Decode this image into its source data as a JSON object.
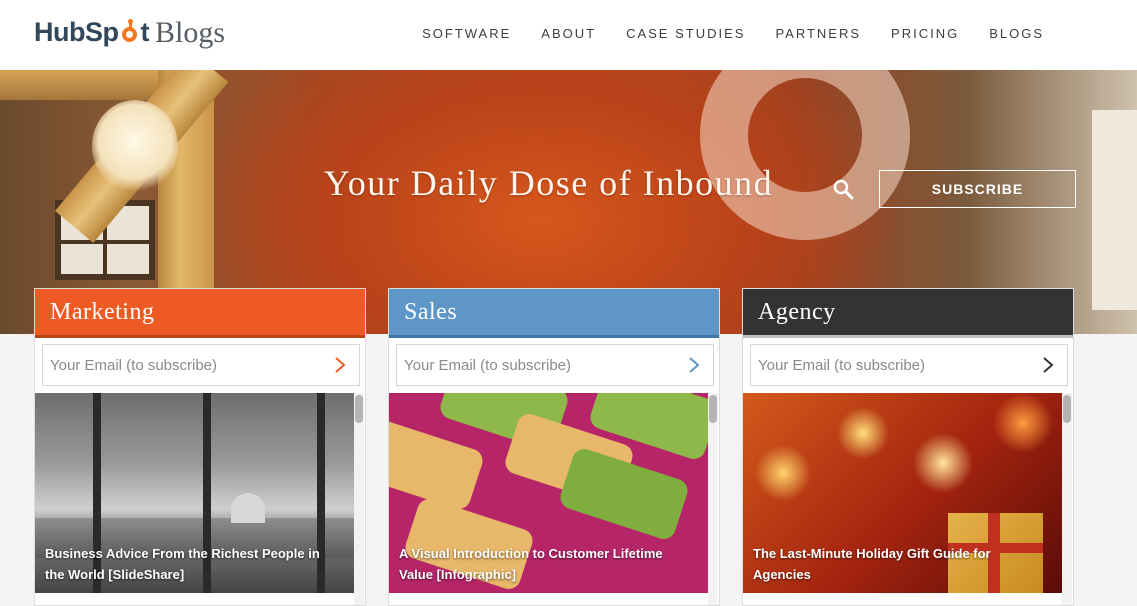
{
  "brand": {
    "logo_hub": "HubSp",
    "logo_t": "t",
    "logo_blogs": "Blogs"
  },
  "nav": [
    {
      "label": "SOFTWARE"
    },
    {
      "label": "ABOUT"
    },
    {
      "label": "CASE STUDIES"
    },
    {
      "label": "PARTNERS"
    },
    {
      "label": "PRICING"
    },
    {
      "label": "BLOGS"
    }
  ],
  "hero": {
    "title": "Your Daily Dose of Inbound",
    "subscribe_label": "SUBSCRIBE",
    "search_icon": "search-icon"
  },
  "cards": [
    {
      "title": "Marketing",
      "color": "#ee5a24",
      "bar_color": "#b9461a",
      "email_placeholder": "Your Email (to subscribe)",
      "arrow_color": "#ee5a24",
      "post_title": "Business Advice From the Richest People in the World [SlideShare]"
    },
    {
      "title": "Sales",
      "color": "#5f96c8",
      "bar_color": "#3f74a6",
      "email_placeholder": "Your Email (to subscribe)",
      "arrow_color": "#5f96c8",
      "post_title": "A Visual Introduction to Customer Lifetime Value [Infographic]"
    },
    {
      "title": "Agency",
      "color": "#333333",
      "bar_color": "#bdbdbd",
      "email_placeholder": "Your Email (to subscribe)",
      "arrow_color": "#333333",
      "post_title": "The Last-Minute Holiday Gift Guide for Agencies"
    }
  ]
}
